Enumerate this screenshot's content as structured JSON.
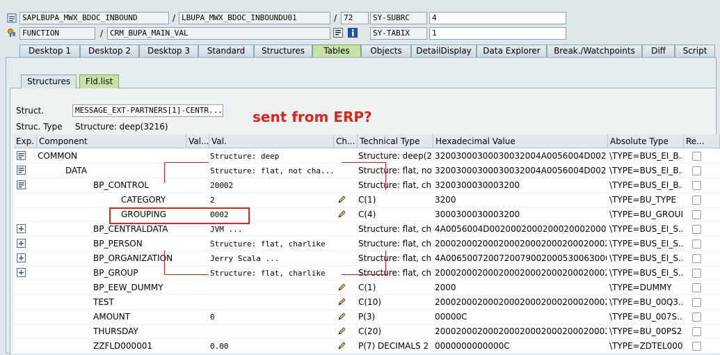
{
  "header": {
    "row1": {
      "program": "SAPLBUPA_MWX_BDOC_INBOUND",
      "include": "LBUPA_MWX_BDOC_INBOUNDU01",
      "line": "72",
      "sy_label": "SY-SUBRC",
      "sy_value": "4"
    },
    "row2": {
      "type": "FUNCTION",
      "name": "CRM_BUPA_MAIN_VAL",
      "sy_label": "SY-TABIX",
      "sy_value": "1"
    }
  },
  "tabs": [
    "Desktop 1",
    "Desktop 2",
    "Desktop 3",
    "Standard",
    "Structures",
    "Tables",
    "Objects",
    "DetailDisplay",
    "Data Explorer",
    "Break./Watchpoints",
    "Diff",
    "Script"
  ],
  "active_tab": "Tables",
  "subtabs": [
    "Structures",
    "Fld.list"
  ],
  "struct": {
    "label": "Struct.",
    "value": "MESSAGE_EXT-PARTNERS[1]-CENTR...",
    "type_label": "Struc. Type",
    "type_value": "Structure: deep(3216)"
  },
  "annotation": "sent from ERP?",
  "columns": [
    "Exp.",
    "Component",
    "Val...",
    "Val.",
    "Ch...",
    "Technical Type",
    "Hexadecimal Value",
    "Absolute Type",
    "Re..."
  ],
  "rows": [
    {
      "exp": "collapse",
      "component": "COMMON",
      "indent": 0,
      "val": "Structure: deep",
      "edit": false,
      "tech": "Structure: deep(2...",
      "hex": "32003000300030032004A0056004D0020...",
      "abs": "\\TYPE=BUS_EI_B..."
    },
    {
      "exp": "collapse",
      "component": "DATA",
      "indent": 1,
      "val": "Structure: flat, not cha...",
      "edit": false,
      "tech": "Structure: flat, no...",
      "hex": "32003000300030032004A0056004D0020...",
      "abs": "\\TYPE=BUS_EI_B..."
    },
    {
      "exp": "collapse",
      "component": "BP_CONTROL",
      "indent": 2,
      "val": "20002",
      "edit": false,
      "tech": "Structure: flat, ch...",
      "hex": "3200300030003200",
      "abs": "\\TYPE=BUS_EI_B..."
    },
    {
      "exp": "",
      "component": "CATEGORY",
      "indent": 3,
      "val": "2",
      "edit": true,
      "tech": "C(1)",
      "hex": "3200",
      "abs": "\\TYPE=BU_TYPE"
    },
    {
      "exp": "",
      "component": "GROUPING",
      "indent": 3,
      "val": "0002",
      "edit": true,
      "tech": "C(4)",
      "hex": "3000300030003200",
      "abs": "\\TYPE=BU_GROUP",
      "selected": true
    },
    {
      "exp": "expand",
      "component": "BP_CENTRALDATA",
      "indent": 2,
      "val": "JVM                    ...",
      "edit": false,
      "tech": "Structure: flat, ch...",
      "hex": "4A0056004D0020002000200020002000200020...",
      "abs": "\\TYPE=BUS_EI_S..."
    },
    {
      "exp": "expand",
      "component": "BP_PERSON",
      "indent": 2,
      "val": "Structure: flat, charlike",
      "edit": false,
      "tech": "Structure: flat, ch...",
      "hex": "2000200020002000200020002000200020...",
      "abs": "\\TYPE=BUS_EI_S..."
    },
    {
      "exp": "expand",
      "component": "BP_ORGANIZATION",
      "indent": 2,
      "val": "Jerry Scala            ...",
      "edit": false,
      "tech": "Structure: flat, ch...",
      "hex": "4A00650072007200790020005300630061...",
      "abs": "\\TYPE=BUS_EI_S..."
    },
    {
      "exp": "expand",
      "component": "BP_GROUP",
      "indent": 2,
      "val": "Structure: flat, charlike",
      "edit": false,
      "tech": "Structure: flat, ch...",
      "hex": "2000200020002000200020002000200020...",
      "abs": "\\TYPE=BUS_EI_S..."
    },
    {
      "exp": "",
      "component": "BP_EEW_DUMMY",
      "indent": 2,
      "val": "",
      "edit": true,
      "tech": "C(1)",
      "hex": "2000",
      "abs": "\\TYPE=DUMMY"
    },
    {
      "exp": "",
      "component": "TEST",
      "indent": 2,
      "val": "",
      "edit": true,
      "tech": "C(10)",
      "hex": "2000200020002000200020002000200020...",
      "abs": "\\TYPE=BU_00Q3..."
    },
    {
      "exp": "",
      "component": "AMOUNT",
      "indent": 2,
      "val": "0",
      "edit": true,
      "tech": "P(3)",
      "hex": "00000C",
      "abs": "\\TYPE=BU_007S..."
    },
    {
      "exp": "",
      "component": "THURSDAY",
      "indent": 2,
      "val": "",
      "edit": true,
      "tech": "C(20)",
      "hex": "2000200020002000200020002000200020...",
      "abs": "\\TYPE=BU_00PS2..."
    },
    {
      "exp": "",
      "component": "ZZFLD000001",
      "indent": 2,
      "val": "0.00",
      "edit": true,
      "tech": "P(7) DECIMALS 2",
      "hex": "0000000000000C",
      "abs": "\\TYPE=ZDTEL000..."
    }
  ]
}
